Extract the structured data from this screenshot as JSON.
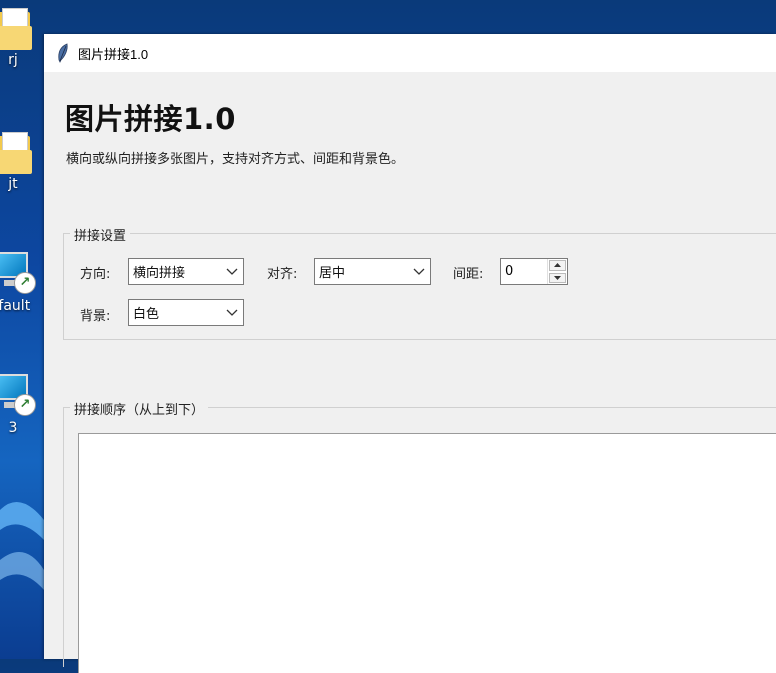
{
  "desktop": {
    "icons": [
      {
        "label": "rj",
        "type": "folder"
      },
      {
        "label": "jt",
        "type": "folder"
      },
      {
        "label": "efault",
        "type": "remote-pc"
      },
      {
        "label": "3",
        "type": "remote-pc"
      }
    ]
  },
  "window": {
    "title": "图片拼接1.0",
    "icon": "feather-icon"
  },
  "app": {
    "heading": "图片拼接1.0",
    "description": "横向或纵向拼接多张图片，支持对齐方式、间距和背景色。"
  },
  "settings": {
    "legend": "拼接设置",
    "direction_label": "方向:",
    "direction_value": "横向拼接",
    "align_label": "对齐:",
    "align_value": "居中",
    "spacing_label": "间距:",
    "spacing_value": "0",
    "background_label": "背景:",
    "background_value": "白色"
  },
  "order": {
    "legend": "拼接顺序（从上到下）"
  }
}
